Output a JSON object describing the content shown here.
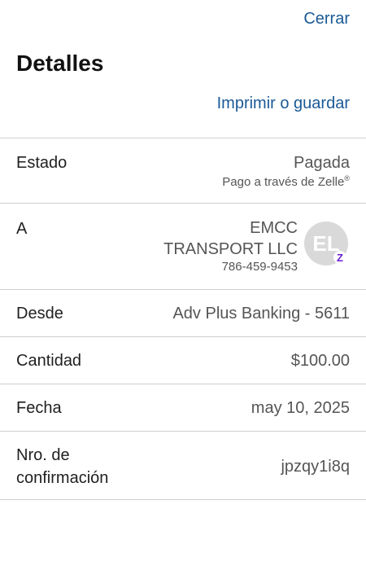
{
  "header": {
    "close_label": "Cerrar",
    "title": "Detalles",
    "print_label": "Imprimir o guardar"
  },
  "status": {
    "label": "Estado",
    "value": "Pagada",
    "method": "Pago a través de Zelle",
    "method_mark": "®"
  },
  "recipient": {
    "label": "A",
    "name_line1": "EMCC",
    "name_line2": "TRANSPORT LLC",
    "phone": "786-459-9453",
    "avatar_initials": "EL",
    "badge_glyph": "Z"
  },
  "from": {
    "label": "Desde",
    "value": "Adv Plus Banking - 5611"
  },
  "amount": {
    "label": "Cantidad",
    "value": "$100.00"
  },
  "date": {
    "label": "Fecha",
    "value": "may 10, 2025"
  },
  "confirmation": {
    "label": "Nro. de confirmación",
    "value": "jpzqy1i8q"
  },
  "colors": {
    "link": "#1a5a96",
    "divider": "#cfcfcf",
    "zelle": "#6d1ed4",
    "avatar_bg": "#d9d9d9"
  }
}
